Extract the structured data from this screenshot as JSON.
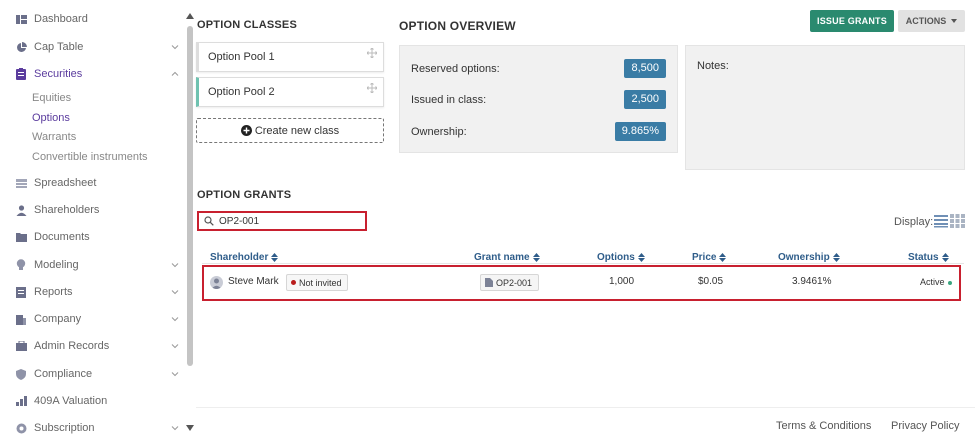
{
  "sidebar": {
    "items": [
      {
        "label": "Dashboard",
        "icon": "dashboard-icon"
      },
      {
        "label": "Cap Table",
        "icon": "pie-chart-icon"
      },
      {
        "label": "Securities",
        "icon": "clipboard-icon"
      },
      {
        "label": "Spreadsheet",
        "icon": "grid-icon"
      },
      {
        "label": "Shareholders",
        "icon": "person-icon"
      },
      {
        "label": "Documents",
        "icon": "folder-icon"
      },
      {
        "label": "Modeling",
        "icon": "lightbulb-icon"
      },
      {
        "label": "Reports",
        "icon": "report-icon"
      },
      {
        "label": "Company",
        "icon": "building-icon"
      },
      {
        "label": "Admin Records",
        "icon": "records-icon"
      },
      {
        "label": "Compliance",
        "icon": "shield-icon"
      },
      {
        "label": "409A Valuation",
        "icon": "valuation-icon"
      },
      {
        "label": "Subscription",
        "icon": "subscription-icon"
      }
    ],
    "securities_sub": [
      "Equities",
      "Options",
      "Warrants",
      "Convertible instruments"
    ],
    "active_sub": "Options"
  },
  "option_classes": {
    "title": "OPTION CLASSES",
    "classes": [
      "Option Pool 1",
      "Option Pool 2"
    ],
    "create_label": "Create new class"
  },
  "overview": {
    "title": "OPTION OVERVIEW",
    "rows": [
      {
        "label": "Reserved options:",
        "value": "8,500"
      },
      {
        "label": "Issued in class:",
        "value": "2,500"
      },
      {
        "label": "Ownership:",
        "value": "9.865%"
      }
    ],
    "notes_label": "Notes:"
  },
  "toolbar": {
    "issue_label": "ISSUE GRANTS",
    "actions_label": "ACTIONS"
  },
  "grants": {
    "title": "OPTION GRANTS",
    "search_value": "OP2-001",
    "display_label": "Display:",
    "columns": [
      "Shareholder",
      "Grant name",
      "Options",
      "Price",
      "Ownership",
      "Status"
    ],
    "rows": [
      {
        "shareholder": "Steve Mark",
        "invite_status": "Not invited",
        "grant_name": "OP2-001",
        "options": "1,000",
        "price": "$0.05",
        "ownership": "3.9461%",
        "status": "Active"
      }
    ]
  },
  "footer": {
    "terms": "Terms & Conditions",
    "privacy": "Privacy Policy"
  },
  "colors": {
    "accent_purple": "#5b3c9e",
    "issue_green": "#2a8a6f",
    "badge_blue": "#3a7ca5",
    "highlight_red": "#c8202f",
    "header_blue": "#2f5d8a"
  }
}
